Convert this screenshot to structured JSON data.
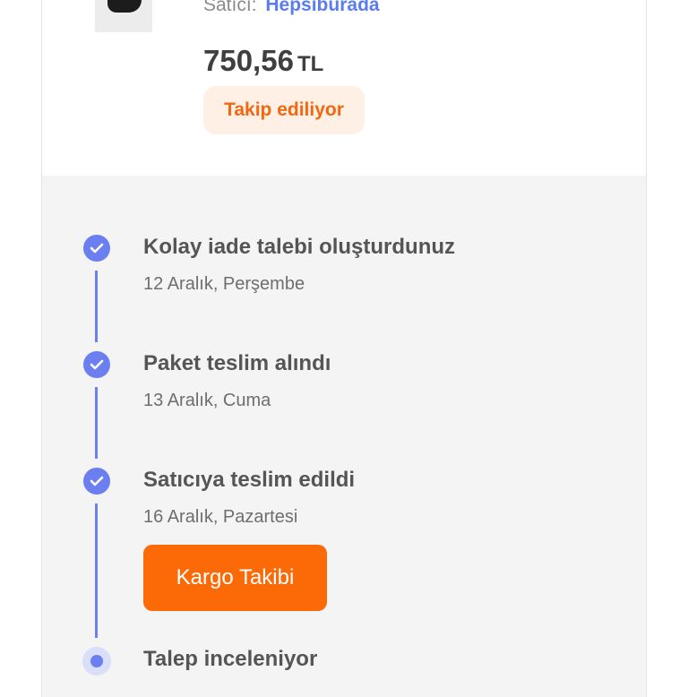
{
  "product": {
    "seller_label": "Satıcı:",
    "seller_name": "Hepsiburada",
    "price": "750,56",
    "currency": "TL",
    "follow_label": "Takip ediliyor",
    "image_icon": "shoe-thumbnail"
  },
  "timeline": {
    "steps": [
      {
        "title": "Kolay iade talebi oluşturdunuz",
        "date": "12 Aralık, Perşembe",
        "status": "done"
      },
      {
        "title": "Paket teslim alındı",
        "date": "13 Aralık, Cuma",
        "status": "done"
      },
      {
        "title": "Satıcıya teslim edildi",
        "date": "16 Aralık, Pazartesi",
        "status": "done"
      },
      {
        "title": "Talep inceleniyor",
        "status": "current"
      }
    ],
    "cargo_button_label": "Kargo Takibi"
  },
  "colors": {
    "accent": "#6b7ff0",
    "orange": "#fb6a07",
    "follow_bg": "#fff0e6",
    "panel_bg": "#f4f4f4"
  }
}
